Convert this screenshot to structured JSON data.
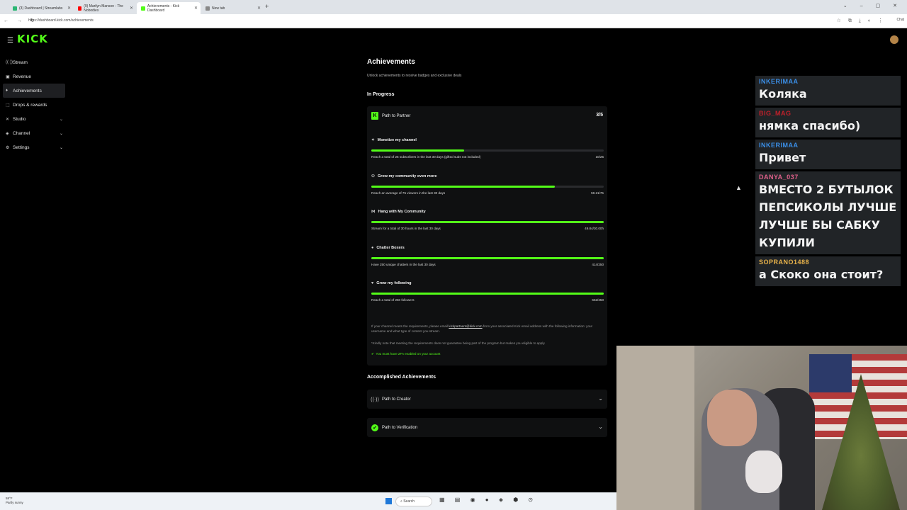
{
  "browser": {
    "tabs": [
      {
        "label": "(3) Dashboard | Streamlabs",
        "color": "#2bb673"
      },
      {
        "label": "(9) Marilyn Manson - The Nobodies",
        "color": "#ff0000"
      },
      {
        "label": "Achievements - Kick Dashboard",
        "color": "#53fc18"
      },
      {
        "label": "New tab",
        "color": "#888888"
      }
    ],
    "url": "https://dashboard.kick.com/achievements",
    "chat_label": "Chat"
  },
  "app": {
    "logo": "KICK",
    "sidebar": [
      {
        "label": "Stream",
        "icon": "stream-icon",
        "glyph": "((·))",
        "chevron": false
      },
      {
        "label": "Revenue",
        "icon": "revenue-icon",
        "glyph": "▣",
        "chevron": false
      },
      {
        "label": "Achievements",
        "icon": "trophy-icon",
        "glyph": "♦",
        "chevron": false,
        "active": true
      },
      {
        "label": "Drops & rewards",
        "icon": "gift-icon",
        "glyph": "⬚",
        "chevron": false
      },
      {
        "label": "Studio",
        "icon": "studio-icon",
        "glyph": "✕",
        "chevron": true
      },
      {
        "label": "Channel",
        "icon": "channel-icon",
        "glyph": "◈",
        "chevron": true
      },
      {
        "label": "Settings",
        "icon": "gear-icon",
        "glyph": "⚙",
        "chevron": true
      }
    ]
  },
  "achievements": {
    "title": "Achievements",
    "subtitle": "Unlock achievements to receive badges and exclusive deals",
    "in_progress_label": "In Progress",
    "path": {
      "badge": "K",
      "name": "Path to Partner",
      "progress": "3/5",
      "tasks": [
        {
          "icon": "✦",
          "title": "Monetize my channel",
          "desc": "Reach a total of 25 subscribers in the last 30 days (gifted subs not included)",
          "value": "10/25",
          "fraction": 0.4
        },
        {
          "icon": "⚇",
          "title": "Grow my community even more",
          "desc": "Reach an average of 75 viewers in the last 30 days",
          "value": "59.21/75",
          "fraction": 0.79
        },
        {
          "icon": "⋈",
          "title": "Hang with My Community",
          "desc": "Stream for a total of 30 hours in the last 30 days",
          "value": "49.84/30.00h",
          "fraction": 1.0
        },
        {
          "icon": "●",
          "title": "Chatter Boxers",
          "desc": "Have 250 unique chatters in the last 30 days",
          "value": "414/250",
          "fraction": 1.0
        },
        {
          "icon": "♥",
          "title": "Grow my following",
          "desc": "Reach a total of 250 followers",
          "value": "662/250",
          "fraction": 1.0
        }
      ],
      "note_prefix": "If your channel meets the requirements, please email ",
      "note_email": "kickpartners@kick.com",
      "note_suffix": " from your associated Kick email address with the following information: your username and what type of content you stream.",
      "note2": "*Kindly note that meeting the requirements does not guarantee being part of the program but makes you eligible to apply.",
      "requirement": "You must have 2FA enabled on your account"
    },
    "accomplished_label": "Accomplished Achievements",
    "accomplished": [
      {
        "name": "Path to Creator",
        "icon": "creator-icon",
        "glyph": "((·))"
      },
      {
        "name": "Path to Verification",
        "icon": "verified-icon",
        "glyph": "✔"
      }
    ]
  },
  "chat": [
    {
      "user": "INKERIMAA",
      "color": "#3a8ee6",
      "text": "Коляка"
    },
    {
      "user": "BIG_MAG",
      "color": "#c0202a",
      "text": "нямка спасибо)"
    },
    {
      "user": "INKERIMAA",
      "color": "#3a8ee6",
      "text": "Привет"
    },
    {
      "user": "DANYA_037",
      "color": "#e0608a",
      "text": "ВМЕСТО 2 БУТЫЛОК ПЕПСИКОЛЫ ЛУЧШЕ ЛУЧШЕ БЫ САБКУ КУПИЛИ"
    },
    {
      "user": "SOPRANO1488",
      "color": "#e8b24a",
      "text": "а Скоко она стоит?"
    }
  ],
  "taskbar": {
    "weather_temp": "58°F",
    "weather_desc": "Partly sunny",
    "search": "Search"
  }
}
